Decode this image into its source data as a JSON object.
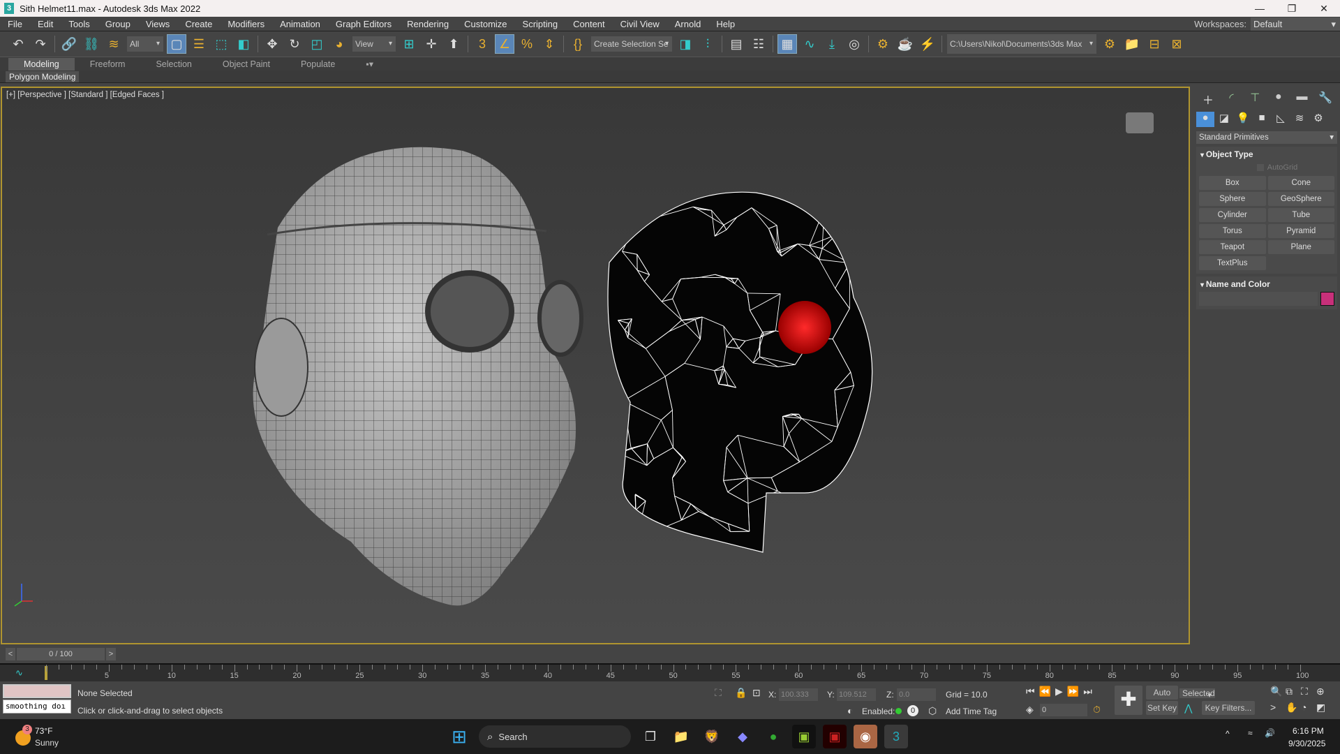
{
  "window": {
    "title": "Sith Helmet11.max - Autodesk 3ds Max 2022",
    "app_icon": "3",
    "minimize": "—",
    "restore": "❐",
    "close": "✕"
  },
  "menu": [
    "File",
    "Edit",
    "Tools",
    "Group",
    "Views",
    "Create",
    "Modifiers",
    "Animation",
    "Graph Editors",
    "Rendering",
    "Customize",
    "Scripting",
    "Content",
    "Civil View",
    "Arnold",
    "Help"
  ],
  "workspaces": {
    "label": "Workspaces:",
    "value": "Default"
  },
  "toolbar": {
    "selection_filter": "All",
    "ref_coord": "View",
    "named_selection": "Create Selection Se",
    "project_path": "C:\\Users\\Nikol\\Documents\\3ds Max 2022"
  },
  "ribbon": {
    "tabs": [
      "Modeling",
      "Freeform",
      "Selection",
      "Object Paint",
      "Populate"
    ],
    "active_tab": "Modeling",
    "panel": "Polygon Modeling"
  },
  "viewport": {
    "label": "[+] [Perspective ] [Standard ] [Edged Faces ]"
  },
  "command_panel": {
    "category": "Standard Primitives",
    "object_type_title": "Object Type",
    "autogrid": "AutoGrid",
    "buttons": [
      "Box",
      "Cone",
      "Sphere",
      "GeoSphere",
      "Cylinder",
      "Tube",
      "Torus",
      "Pyramid",
      "Teapot",
      "Plane",
      "TextPlus"
    ],
    "name_color_title": "Name and Color",
    "object_color": "#c8307a"
  },
  "timeline": {
    "frame_display": "0 / 100",
    "prev": "<",
    "next": ">",
    "start": 0,
    "end": 100,
    "label_step": 5
  },
  "status": {
    "maxscript_output": "smoothing doı",
    "selection": "None Selected",
    "prompt": "Click or click-and-drag to select objects",
    "x_label": "X:",
    "x": "100.333",
    "y_label": "Y:",
    "y": "109.512",
    "z_label": "Z:",
    "z": "0.0",
    "grid": "Grid = 10.0",
    "enabled_label": "Enabled:",
    "enabled_count": "0",
    "add_time_tag": "Add Time Tag",
    "current_frame": "0",
    "auto_key": "Auto Key",
    "set_key": "Set Key",
    "key_mode": "Selected",
    "key_filters": "Key Filters..."
  },
  "taskbar": {
    "weather_temp": "73°F",
    "weather_desc": "Sunny",
    "weather_badge": "3",
    "search": "Search",
    "time": "6:16 PM",
    "date": "9/30/2025"
  }
}
